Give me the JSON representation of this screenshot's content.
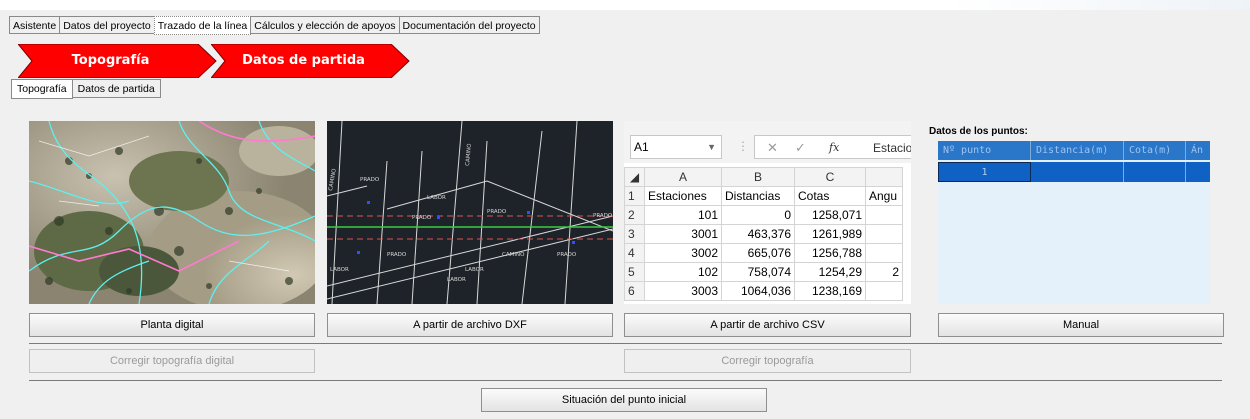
{
  "main_tabs": [
    "Asistente",
    "Datos del proyecto",
    "Trazado de la línea",
    "Cálculos y elección de apoyos",
    "Documentación del proyecto"
  ],
  "active_main_tab": "Trazado de la línea",
  "steps": [
    "Topografía",
    "Datos de partida"
  ],
  "sub_tabs": [
    "Topografía",
    "Datos de partida"
  ],
  "cad_labels": [
    "PRADO",
    "PRADO",
    "PRADO",
    "PRADO",
    "PRADO",
    "PRADO",
    "LABOR",
    "LABOR",
    "LABOR",
    "LABOR",
    "CAMINO",
    "CAMINO",
    "CAMINO"
  ],
  "excel": {
    "namebox": "A1",
    "formula_preview": "Estacio",
    "fx": "fx",
    "columns": [
      "A",
      "B",
      "C"
    ],
    "rows": [
      {
        "n": "1",
        "a": "Estaciones",
        "b": "Distancias",
        "c": "Cotas",
        "d": "Angu"
      },
      {
        "n": "2",
        "a": "101",
        "b": "0",
        "c": "1258,071",
        "d": ""
      },
      {
        "n": "3",
        "a": "3001",
        "b": "463,376",
        "c": "1261,989",
        "d": ""
      },
      {
        "n": "4",
        "a": "3002",
        "b": "665,076",
        "c": "1256,788",
        "d": ""
      },
      {
        "n": "5",
        "a": "102",
        "b": "758,074",
        "c": "1254,29",
        "d": "2"
      },
      {
        "n": "6",
        "a": "3003",
        "b": "1064,036",
        "c": "1238,169",
        "d": ""
      }
    ]
  },
  "points": {
    "title": "Datos de los puntos:",
    "headers": [
      "Nº punto",
      "Distancia(m)",
      "Cota(m)",
      "Án"
    ],
    "row": [
      "1",
      "",
      "",
      ""
    ]
  },
  "buttons": {
    "planta_digital": "Planta digital",
    "dxf": "A partir de archivo DXF",
    "csv": "A partir de archivo CSV",
    "manual": "Manual",
    "corregir_digital": "Corregir topografía digital",
    "corregir": "Corregir topografía",
    "situacion": "Situación del punto inicial"
  },
  "colors": {
    "step_red": "#ff0000",
    "grid_header": "#2a76c9",
    "grid_row": "#0f62c4",
    "grid_bg": "#e4f1fa"
  }
}
